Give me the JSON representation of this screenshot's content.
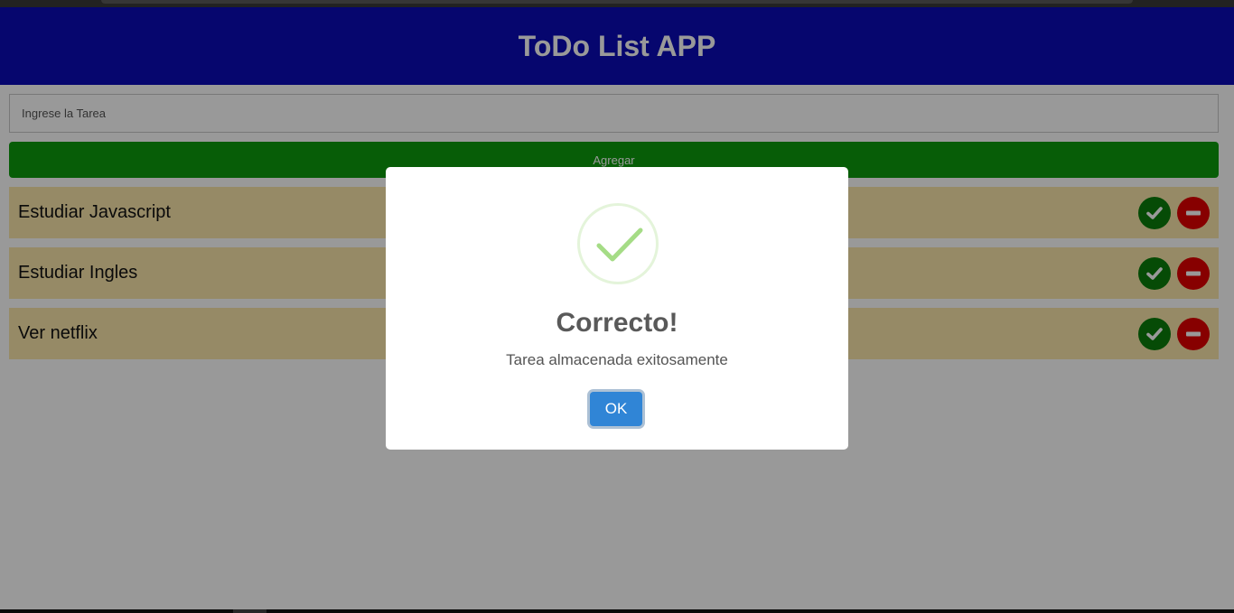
{
  "app": {
    "title": "ToDo List APP",
    "colors": {
      "header_bg": "#0a0ab8",
      "add_button_bg": "#0d9c0d",
      "task_bg": "#fae6ab",
      "done_icon_bg": "#0a7d0a",
      "remove_icon_bg": "#e10000"
    }
  },
  "form": {
    "task_input_placeholder": "Ingrese la Tarea",
    "task_input_value": "",
    "add_button_label": "Agregar"
  },
  "tasks": [
    {
      "text": "Estudiar Javascript",
      "done_icon": "check-circle-icon",
      "remove_icon": "minus-circle-icon"
    },
    {
      "text": "Estudiar Ingles",
      "done_icon": "check-circle-icon",
      "remove_icon": "minus-circle-icon"
    },
    {
      "text": "Ver netflix",
      "done_icon": "check-circle-icon",
      "remove_icon": "minus-circle-icon"
    }
  ],
  "modal": {
    "icon": "success-check-icon",
    "title": "Correcto!",
    "text": "Tarea almacenada exitosamente",
    "ok_label": "OK",
    "colors": {
      "ok_bg": "#3085d6",
      "success_green": "#a5dc86"
    }
  }
}
